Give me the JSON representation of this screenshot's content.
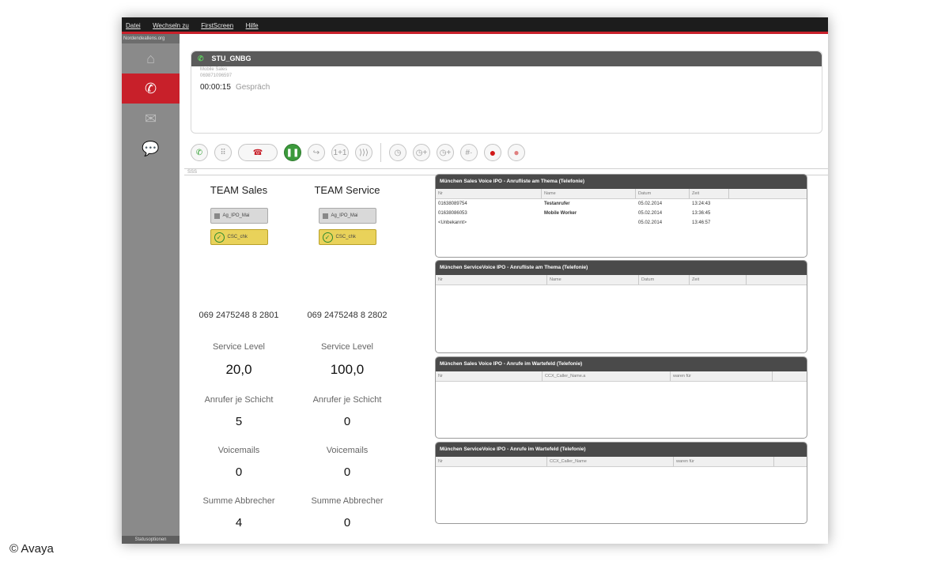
{
  "menu": [
    "Datei",
    "Wechseln zu",
    "FirstScreen",
    "Hilfe"
  ],
  "sidebar": {
    "top_label": "Nordendeallens.org",
    "items": [
      {
        "name": "home-icon",
        "glyph": "⌂"
      },
      {
        "name": "phone-icon",
        "glyph": "✆"
      },
      {
        "name": "mail-icon",
        "glyph": "✉"
      },
      {
        "name": "chat-icon",
        "glyph": "💬"
      }
    ],
    "bottom_label": "Statusoptionen"
  },
  "call": {
    "title": "STU_GNBG",
    "caller_name": "Mobile Sales",
    "caller_number": "069871096597",
    "timer": "00:00:15",
    "state": "Gespräch"
  },
  "toolbar": {
    "answer": "✆",
    "keypad": "⠿",
    "hangup": "☎",
    "hold": "❚❚",
    "transfer": "↪",
    "conference": "1+1",
    "park": "⟩⟩⟩",
    "timer1": "◷",
    "timer2": "◷+",
    "timer3": "◷+",
    "hash": "#·",
    "record": "●",
    "stop": "●"
  },
  "divider_label": "SSS",
  "teams": [
    {
      "title": "TEAM Sales",
      "tag_gray": "Ag_IPO_Mai",
      "tag_yellow": "CSC_chk",
      "phone": "069 2475248 8 2801",
      "service_level_label": "Service Level",
      "service_level": "20,0",
      "callers_label": "Anrufer je Schicht",
      "callers": "5",
      "voicemails_label": "Voicemails",
      "voicemails": "0",
      "aborts_label": "Summe Abbrecher",
      "aborts": "4"
    },
    {
      "title": "TEAM  Service",
      "tag_gray": "Ag_IPO_Mai",
      "tag_yellow": "CSC_chk",
      "phone": "069 2475248 8 2802",
      "service_level_label": "Service Level",
      "service_level": "100,0",
      "callers_label": "Anrufer je Schicht",
      "callers": "0",
      "voicemails_label": "Voicemails",
      "voicemails": "0",
      "aborts_label": "Summe Abbrecher",
      "aborts": "0"
    }
  ],
  "lists": [
    {
      "title": "München Sales Voice IPO - Anrufliste am Thema (Telefonie)",
      "columns": [
        "Nr",
        "Name",
        "Datum",
        "Zeit"
      ],
      "rows": [
        [
          "01638089754",
          "Testanrufer",
          "05.02.2014",
          "13:24:43"
        ],
        [
          "01638086053",
          "Mobile Worker",
          "05.02.2014",
          "13:36:45"
        ],
        [
          "<Unbekannt>",
          "",
          "05.02.2014",
          "13:46:57"
        ]
      ]
    },
    {
      "title": "München ServiceVoice IPO - Anrufliste am Thema (Telefonie)",
      "columns": [
        "Nr",
        "Name",
        "Datum",
        "Zeit"
      ],
      "rows": []
    },
    {
      "title": "München Sales Voice IPO - Anrufe im Wartefeld (Telefonie)",
      "columns": [
        "Nr",
        "CCX_Caller_Name.a",
        "waren für"
      ],
      "rows": []
    },
    {
      "title": "München ServiceVoice IPO - Anrufe im Wartefeld (Telefonie)",
      "columns": [
        "Nr",
        "CCX_Caller_Name",
        "waren für"
      ],
      "rows": []
    }
  ],
  "credit": "© Avaya"
}
